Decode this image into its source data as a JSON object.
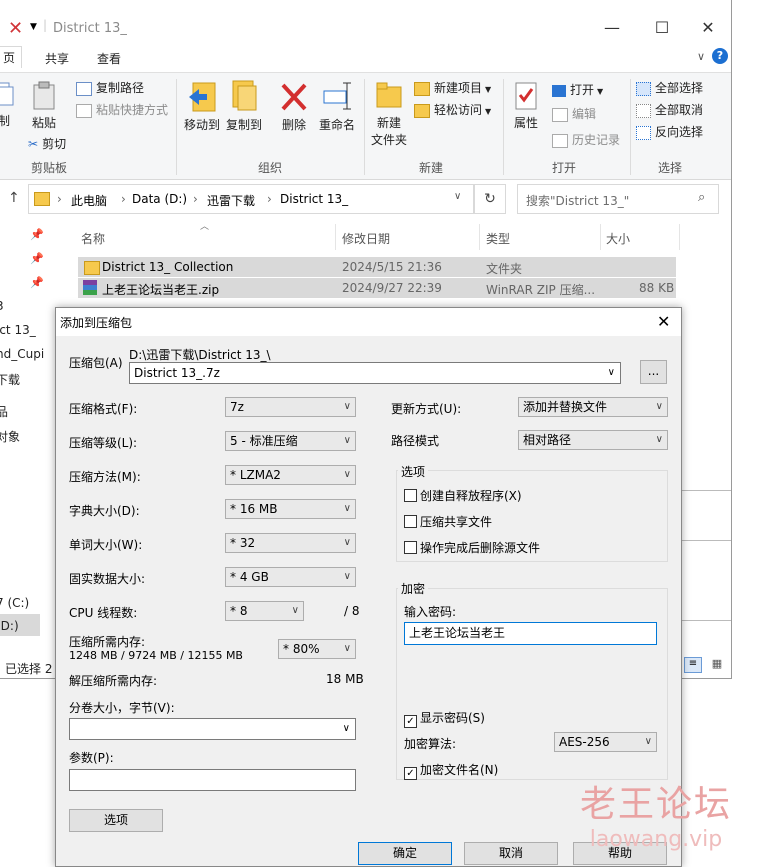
{
  "explorer": {
    "title": "District 13_",
    "ribbon_tabs": [
      "页",
      "共享",
      "查看"
    ],
    "ribbon": {
      "clipboard": {
        "label": "剪贴板",
        "paste": "粘贴",
        "copy_path": "复制路径",
        "paste_shortcut": "粘贴快捷方式",
        "cut": "剪切",
        "copy_partial": "制"
      },
      "organize": {
        "label": "组织",
        "move_to": "移动到",
        "copy_to": "复制到",
        "delete": "删除",
        "rename": "重命名"
      },
      "new": {
        "label": "新建",
        "new_folder": "新建\n文件夹",
        "new_folder_l1": "新建",
        "new_folder_l2": "文件夹",
        "new_item": "新建项目",
        "easy_access": "轻松访问"
      },
      "open": {
        "label": "打开",
        "properties": "属性",
        "open": "打开",
        "edit": "编辑",
        "history": "历史记录"
      },
      "select": {
        "label": "选择",
        "select_all": "全部选择",
        "select_none": "全部取消",
        "invert": "反向选择"
      }
    },
    "breadcrumb": [
      "此电脑",
      "Data (D:)",
      "迅雷下载",
      "District 13_"
    ],
    "search_placeholder": "搜索\"District 13_\"",
    "columns": {
      "name": "名称",
      "modified": "修改日期",
      "type": "类型",
      "size": "大小"
    },
    "files": [
      {
        "name": "District 13_ Collection",
        "modified": "2024/5/15 21:36",
        "type": "文件夹",
        "size": ""
      },
      {
        "name": "上老王论坛当老王.zip",
        "modified": "2024/9/27 22:39",
        "type": "WinRAR ZIP 压缩...",
        "size": "88 KB"
      }
    ],
    "left_nav": [
      "3",
      "ict 13_",
      "nd_Cupi",
      "下载",
      "品",
      "对象",
      "7 (C:)",
      "(D:)"
    ],
    "status": "已选择 2"
  },
  "dialog": {
    "title": "添加到压缩包",
    "archive_label": "压缩包(A)",
    "archive_path": "D:\\迅雷下载\\District 13_\\",
    "archive_name": "District 13_.7z",
    "browse_label": "...",
    "left_fields": [
      {
        "label": "压缩格式(F):",
        "value": "7z"
      },
      {
        "label": "压缩等级(L):",
        "value": "5 - 标准压缩"
      },
      {
        "label": "压缩方法(M):",
        "value": "*  LZMA2"
      },
      {
        "label": "字典大小(D):",
        "value": "*  16 MB"
      },
      {
        "label": "单词大小(W):",
        "value": "*  32"
      },
      {
        "label": "固实数据大小:",
        "value": "*  4 GB"
      }
    ],
    "cpu_label": "CPU 线程数:",
    "cpu_value": "*  8",
    "cpu_total": "/ 8",
    "mem_label": "压缩所需内存:",
    "mem_detail": "1248 MB / 9724 MB / 12155 MB",
    "mem_percent": "*  80%",
    "decomp_label": "解压缩所需内存:",
    "decomp_value": "18 MB",
    "split_label": "分卷大小，字节(V):",
    "params_label": "参数(P):",
    "options_button": "选项",
    "update_label": "更新方式(U):",
    "update_value": "添加并替换文件",
    "path_label": "路径模式",
    "path_value": "相对路径",
    "options_group": "选项",
    "options": [
      {
        "label": "创建自释放程序(X)",
        "checked": false
      },
      {
        "label": "压缩共享文件",
        "checked": false
      },
      {
        "label": "操作完成后删除源文件",
        "checked": false
      }
    ],
    "encrypt_group": "加密",
    "password_label": "输入密码:",
    "password_value": "上老王论坛当老王",
    "show_password": "显示密码(S)",
    "algo_label": "加密算法:",
    "algo_value": "AES-256",
    "encrypt_names": "加密文件名(N)",
    "ok": "确定",
    "cancel": "取消",
    "help": "帮助"
  },
  "watermark": {
    "line1": "老王论坛",
    "line2": "laowang.vip"
  },
  "colors": {
    "accent": "#0078d7",
    "selection": "#d9d9d9",
    "watermark": "#e8a0a0"
  }
}
